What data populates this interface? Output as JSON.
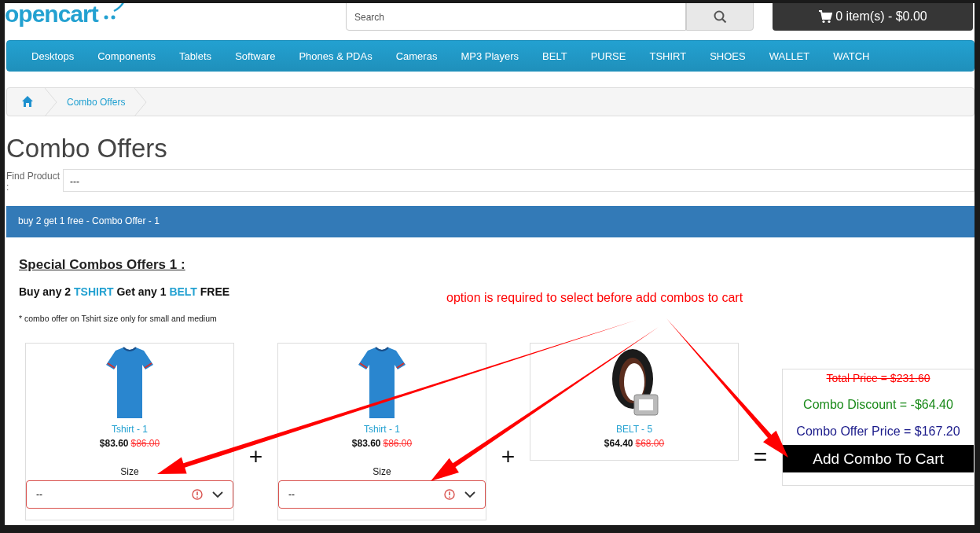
{
  "header": {
    "logo": "opencart",
    "search": {
      "placeholder": "Search"
    },
    "cart": {
      "label": "0 item(s) - $0.00"
    }
  },
  "nav": [
    {
      "label": "Desktops"
    },
    {
      "label": "Components"
    },
    {
      "label": "Tablets"
    },
    {
      "label": "Software"
    },
    {
      "label": "Phones & PDAs"
    },
    {
      "label": "Cameras"
    },
    {
      "label": "MP3 Players"
    },
    {
      "label": "BELT"
    },
    {
      "label": "PURSE"
    },
    {
      "label": "TSHIRT"
    },
    {
      "label": "SHOES"
    },
    {
      "label": "WALLET"
    },
    {
      "label": "WATCH"
    }
  ],
  "breadcrumb": [
    {
      "kind": "home"
    },
    {
      "kind": "link",
      "label": "Combo Offers"
    }
  ],
  "title": "Combo Offers",
  "find_product": {
    "label": "Find Product :",
    "value": "---"
  },
  "offer": {
    "heading": "buy 2 get 1 free - Combo Offer - 1",
    "title": "Special Combos Offers 1 :",
    "rule": [
      {
        "kind": "plain",
        "text": "Buy any 2"
      },
      {
        "kind": "link",
        "text": "TSHIRT"
      },
      {
        "kind": "plain",
        "text": "Get any 1"
      },
      {
        "kind": "link",
        "text": "BELT"
      },
      {
        "kind": "plain",
        "text": "FREE"
      }
    ],
    "note": "* combo offer on Tshirt size only for small and medium",
    "products": [
      {
        "kind": "tshirt",
        "name": "Tshirt - 1",
        "price": "$83.60",
        "old_price": "$86.00",
        "option": {
          "label": "Size",
          "value": "--",
          "error": true
        }
      },
      {
        "kind": "tshirt",
        "name": "Tshirt - 1",
        "price": "$83.60",
        "old_price": "$86.00",
        "option": {
          "label": "Size",
          "value": "--",
          "error": true
        }
      },
      {
        "kind": "belt",
        "name": "BELT - 5",
        "price": "$64.40",
        "old_price": "$68.00"
      }
    ],
    "separators": [
      "+",
      "+",
      "="
    ],
    "summary": {
      "total": "Total Price = $231.60",
      "discount": "Combo Discount = -$64.40",
      "offer_price": "Combo Offer Price = $167.20",
      "button": "Add Combo To Cart"
    }
  },
  "annotation": {
    "text": "option is required to select before add combos to cart"
  }
}
